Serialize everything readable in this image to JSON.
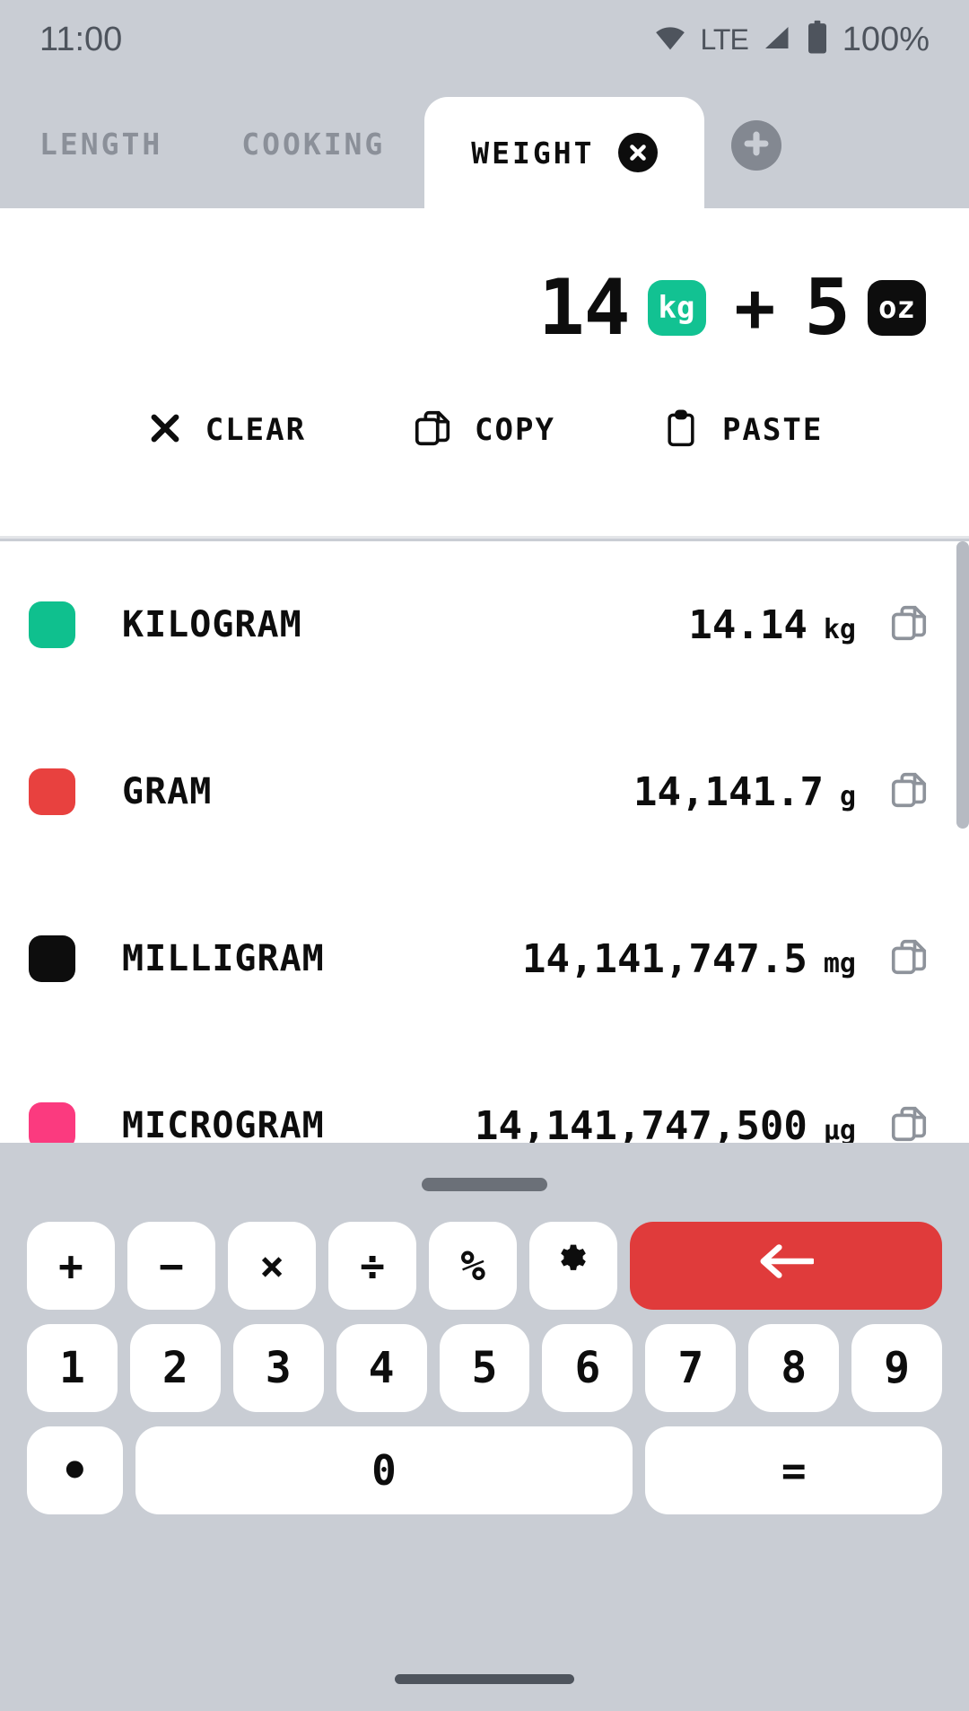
{
  "statusbar": {
    "time": "11:00",
    "network_label": "LTE",
    "battery_label": "100%",
    "wifi_icon": "wifi-icon",
    "signal_icon": "cell-signal-icon",
    "battery_icon": "battery-icon"
  },
  "tabs": {
    "items": [
      {
        "label": "LENGTH",
        "active": false
      },
      {
        "label": "COOKING",
        "active": false
      },
      {
        "label": "WEIGHT",
        "active": true
      }
    ],
    "close_icon": "close-icon",
    "add_tab_icon": "plus-icon"
  },
  "display": {
    "expression": {
      "term1_value": "14",
      "term1_unit": "kg",
      "term1_unit_color": "#12c292",
      "operator": "+",
      "term2_value": "5",
      "term2_unit": "oz",
      "term2_unit_color": "#0d0d0d"
    },
    "actions": [
      {
        "label": "CLEAR",
        "icon": "x-mark-icon"
      },
      {
        "label": "COPY",
        "icon": "copy-icon"
      },
      {
        "label": "PASTE",
        "icon": "clipboard-icon"
      }
    ]
  },
  "conversions": {
    "rows": [
      {
        "name": "KILOGRAM",
        "value": "14.14",
        "unit": "kg",
        "color": "#0fc08e",
        "copy_icon": "copy-icon"
      },
      {
        "name": "GRAM",
        "value": "14,141.7",
        "unit": "g",
        "color": "#e8413f",
        "copy_icon": "copy-icon"
      },
      {
        "name": "MILLIGRAM",
        "value": "14,141,747.5",
        "unit": "mg",
        "color": "#0d0d0d",
        "copy_icon": "copy-icon"
      },
      {
        "name": "MICROGRAM",
        "value": "14,141,747,500",
        "unit": "µg",
        "color": "#fb3a7f",
        "copy_icon": "copy-icon"
      }
    ]
  },
  "keypad": {
    "row_operators": [
      {
        "label": "+",
        "name": "key-plus"
      },
      {
        "label": "−",
        "name": "key-minus"
      },
      {
        "label": "×",
        "name": "key-multiply"
      },
      {
        "label": "÷",
        "name": "key-divide"
      },
      {
        "label": "%",
        "name": "key-percent"
      },
      {
        "label": "",
        "name": "key-settings"
      },
      {
        "label": "←",
        "name": "key-backspace"
      }
    ],
    "row_numbers": [
      "1",
      "2",
      "3",
      "4",
      "5",
      "6",
      "7",
      "8",
      "9"
    ],
    "row_bottom": [
      {
        "label": "•",
        "name": "key-decimal"
      },
      {
        "label": "0",
        "name": "key-zero"
      },
      {
        "label": "=",
        "name": "key-equals"
      }
    ],
    "backspace_color": "#e03b3b"
  }
}
